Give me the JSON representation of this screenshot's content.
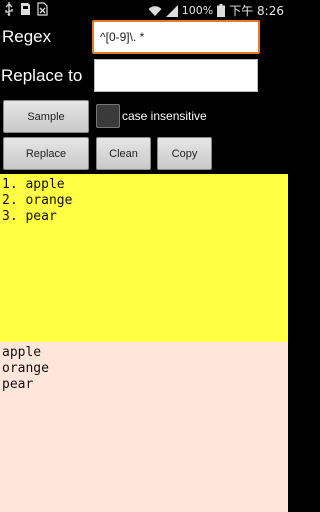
{
  "status_bar": {
    "battery": "100%",
    "time": "下午 8:26",
    "icons": [
      "usb-icon",
      "sd-card-icon",
      "sim-off-icon",
      "wifi-icon",
      "signal-icon",
      "battery-icon"
    ]
  },
  "form": {
    "regex_label": "Regex",
    "regex_value": "^[0-9]\\. *",
    "replace_label": "Replace to",
    "replace_value": ""
  },
  "buttons": {
    "sample": "Sample",
    "replace": "Replace",
    "clean": "Clean",
    "copy": "Copy"
  },
  "options": {
    "case_insensitive_label": "case insensitive",
    "case_insensitive_checked": false
  },
  "input_text": [
    "1. apple",
    "2. orange",
    "3. pear"
  ],
  "output_text": [
    "apple",
    "orange",
    "pear"
  ],
  "colors": {
    "input_bg": "#ffff44",
    "output_bg": "#ffe6da",
    "focus_border": "#e97a20"
  }
}
